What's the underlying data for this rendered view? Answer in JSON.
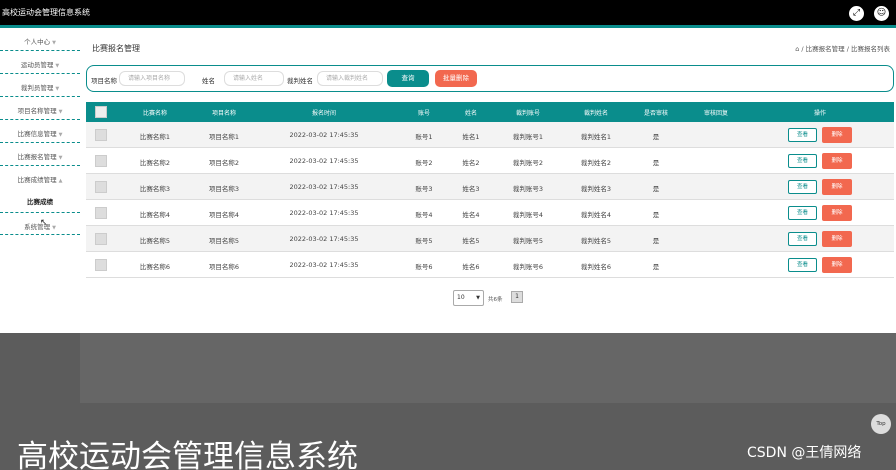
{
  "app": {
    "title": "高校运动会管理信息系统"
  },
  "topbar": {
    "expand_icon": "expand-icon",
    "user_icon": "user-icon"
  },
  "sidebar": {
    "items": [
      {
        "label": "个人中心"
      },
      {
        "label": "运动员管理"
      },
      {
        "label": "裁判员管理"
      },
      {
        "label": "项目名称管理"
      },
      {
        "label": "比赛信息管理"
      },
      {
        "label": "比赛报名管理"
      },
      {
        "label": "比赛成绩管理"
      },
      {
        "label": "系统管理"
      }
    ],
    "submenu": {
      "label": "比赛成绩"
    }
  },
  "page": {
    "title": "比赛报名管理",
    "breadcrumb": "/ 比赛报名管理 / 比赛报名列表"
  },
  "search": {
    "project_label": "项目名称",
    "project_placeholder": "请输入项目名称",
    "name_label": "姓名",
    "name_placeholder": "请输入姓名",
    "judge_label": "裁判姓名",
    "judge_placeholder": "请输入裁判姓名",
    "search_button": "查询",
    "batch_delete_button": "批量删除"
  },
  "table": {
    "columns": [
      "比赛名称",
      "项目名称",
      "报名时间",
      "账号",
      "姓名",
      "裁判账号",
      "裁判姓名",
      "是否审核",
      "审核回复",
      "操作"
    ],
    "view_label": "查看",
    "delete_label": "删除",
    "rows": [
      [
        "比赛名称1",
        "项目名称1",
        "2022-03-02 17:45:35",
        "账号1",
        "姓名1",
        "裁判账号1",
        "裁判姓名1",
        "是",
        ""
      ],
      [
        "比赛名称2",
        "项目名称2",
        "2022-03-02 17:45:35",
        "账号2",
        "姓名2",
        "裁判账号2",
        "裁判姓名2",
        "是",
        ""
      ],
      [
        "比赛名称3",
        "项目名称3",
        "2022-03-02 17:45:35",
        "账号3",
        "姓名3",
        "裁判账号3",
        "裁判姓名3",
        "是",
        ""
      ],
      [
        "比赛名称4",
        "项目名称4",
        "2022-03-02 17:45:35",
        "账号4",
        "姓名4",
        "裁判账号4",
        "裁判姓名4",
        "是",
        ""
      ],
      [
        "比赛名称5",
        "项目名称5",
        "2022-03-02 17:45:35",
        "账号5",
        "姓名5",
        "裁判账号5",
        "裁判姓名5",
        "是",
        ""
      ],
      [
        "比赛名称6",
        "项目名称6",
        "2022-03-02 17:45:35",
        "账号6",
        "姓名6",
        "裁判账号6",
        "裁判姓名6",
        "是",
        ""
      ]
    ]
  },
  "pager": {
    "page_size": "10",
    "total": "共6条",
    "current_page": "1"
  },
  "overlay": {
    "caption": "高校运动会管理信息系统",
    "watermark": "CSDN @王倩网络",
    "top_label": "Top"
  },
  "colors": {
    "accent": "#0a8d8c",
    "danger": "#f2684f"
  }
}
